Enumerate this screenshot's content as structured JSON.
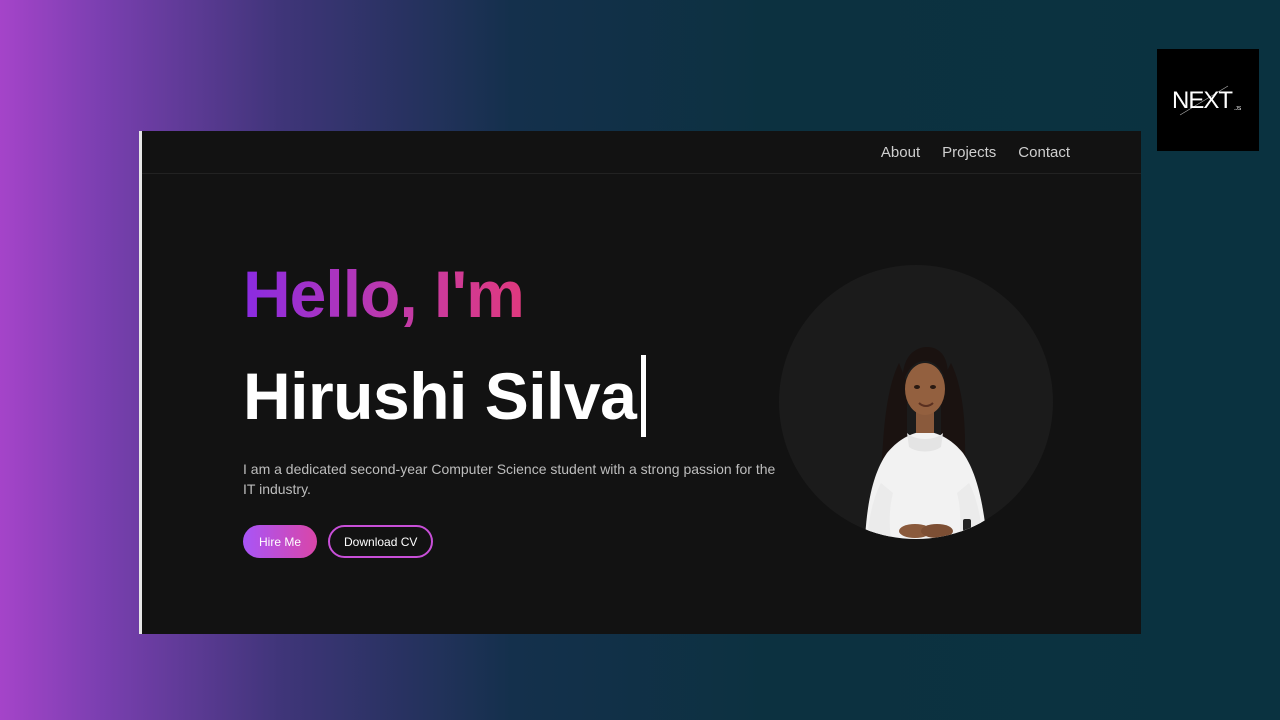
{
  "nav": {
    "links": [
      "About",
      "Projects",
      "Contact"
    ]
  },
  "hero": {
    "greeting": "Hello, I'm",
    "name": "Hirushi Silva",
    "intro": "I am a dedicated second-year Computer Science student with a strong passion for the IT industry.",
    "hire_label": "Hire Me",
    "cv_label": "Download CV"
  },
  "badge": {
    "logo_text": "NEXT",
    "logo_suffix": ".JS"
  },
  "colors": {
    "accent_start": "#8a2be2",
    "accent_end": "#e0397e",
    "button_gradient_start": "#a855f7",
    "button_gradient_end": "#d946a8",
    "page_background": "#121212"
  },
  "icons": {
    "cursor": "text-cursor",
    "logo": "nextjs-logo"
  }
}
